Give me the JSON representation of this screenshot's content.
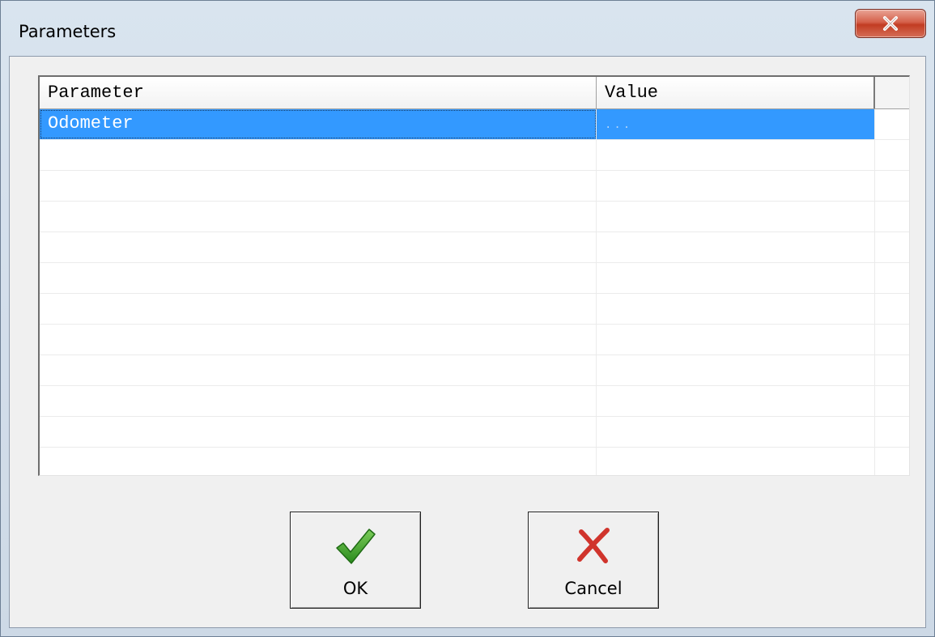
{
  "window": {
    "title": "Parameters",
    "close_symbol": "×"
  },
  "grid": {
    "columns": [
      "Parameter",
      "Value"
    ],
    "rows": [
      {
        "parameter": "Odometer",
        "value": "...",
        "selected": true
      },
      {
        "parameter": "",
        "value": "",
        "selected": false
      },
      {
        "parameter": "",
        "value": "",
        "selected": false
      },
      {
        "parameter": "",
        "value": "",
        "selected": false
      },
      {
        "parameter": "",
        "value": "",
        "selected": false
      },
      {
        "parameter": "",
        "value": "",
        "selected": false
      },
      {
        "parameter": "",
        "value": "",
        "selected": false
      },
      {
        "parameter": "",
        "value": "",
        "selected": false
      },
      {
        "parameter": "",
        "value": "",
        "selected": false
      },
      {
        "parameter": "",
        "value": "",
        "selected": false
      },
      {
        "parameter": "",
        "value": "",
        "selected": false
      },
      {
        "parameter": "",
        "value": "",
        "selected": false
      }
    ]
  },
  "buttons": {
    "ok": {
      "label": "OK",
      "icon": "green-checkmark-icon"
    },
    "cancel": {
      "label": "Cancel",
      "icon": "red-x-icon"
    }
  },
  "colors": {
    "selection": "#3399ff",
    "ok_icon": "#3a9a2a",
    "cancel_icon": "#d0342c",
    "close_button": "#c7472e"
  }
}
